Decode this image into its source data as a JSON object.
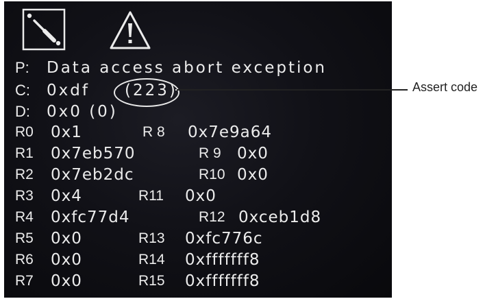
{
  "screen": {
    "icons": [
      "screwdriver-icon",
      "warning-icon"
    ],
    "lines": {
      "p": {
        "prefix": "P:",
        "text": "Data access abort exception"
      },
      "c": {
        "prefix": "C:",
        "hex": "0xdf",
        "dec": "(223)"
      },
      "d": {
        "prefix": "D:",
        "text": "0x0 (0)"
      }
    },
    "registers": [
      {
        "l1": "R0",
        "v1": "0x1",
        "l2": "R 8",
        "v2": "0x7e9a64"
      },
      {
        "l1": "R1",
        "v1": "0x7eb570",
        "l2": "R 9",
        "v2": "0x0"
      },
      {
        "l1": "R2",
        "v1": "0x7eb2dc",
        "l2": "R10",
        "v2": "0x0"
      },
      {
        "l1": "R3",
        "v1": "0x4",
        "l2": "R11",
        "v2": "0x0"
      },
      {
        "l1": "R4",
        "v1": "0xfc77d4",
        "l2": "R12",
        "v2": "0xceb1d8"
      },
      {
        "l1": "R5",
        "v1": "0x0",
        "l2": "R13",
        "v2": "0xfc776c"
      },
      {
        "l1": "R6",
        "v1": "0x0",
        "l2": "R14",
        "v2": "0xfffffff8"
      },
      {
        "l1": "R7",
        "v1": "0x0",
        "l2": "R15",
        "v2": "0xfffffff8"
      }
    ]
  },
  "annotation": {
    "label": "Assert code"
  }
}
